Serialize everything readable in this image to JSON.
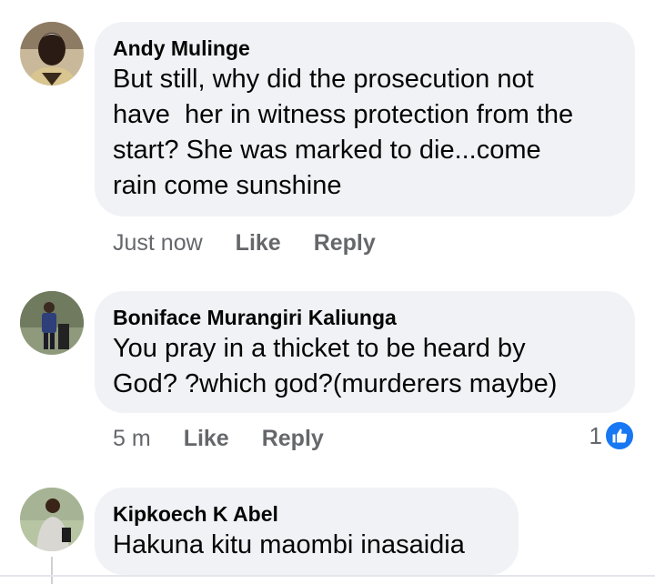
{
  "comments": [
    {
      "author": "Andy Mulinge",
      "text": "But still, why did the prosecution not\nhave  her in witness protection from the\nstart? She was marked to die...come\nrain come sunshine",
      "time": "Just now",
      "like_label": "Like",
      "reply_label": "Reply",
      "avatar_icon": "profile-photo"
    },
    {
      "author": "Boniface Murangiri Kaliunga",
      "text": "You pray in a thicket to be heard by\nGod? ?which god?(murderers maybe)",
      "time": "5 m",
      "like_label": "Like",
      "reply_label": "Reply",
      "reaction_count": "1",
      "reaction_icon": "like-thumb-icon",
      "avatar_icon": "profile-photo"
    },
    {
      "author": "Kipkoech K Abel",
      "text": "Hakuna kitu maombi inasaidia",
      "avatar_icon": "profile-photo"
    }
  ],
  "colors": {
    "bubble_bg": "#f0f2f5",
    "meta_text": "#65676b",
    "like_blue": "#1877f2"
  }
}
